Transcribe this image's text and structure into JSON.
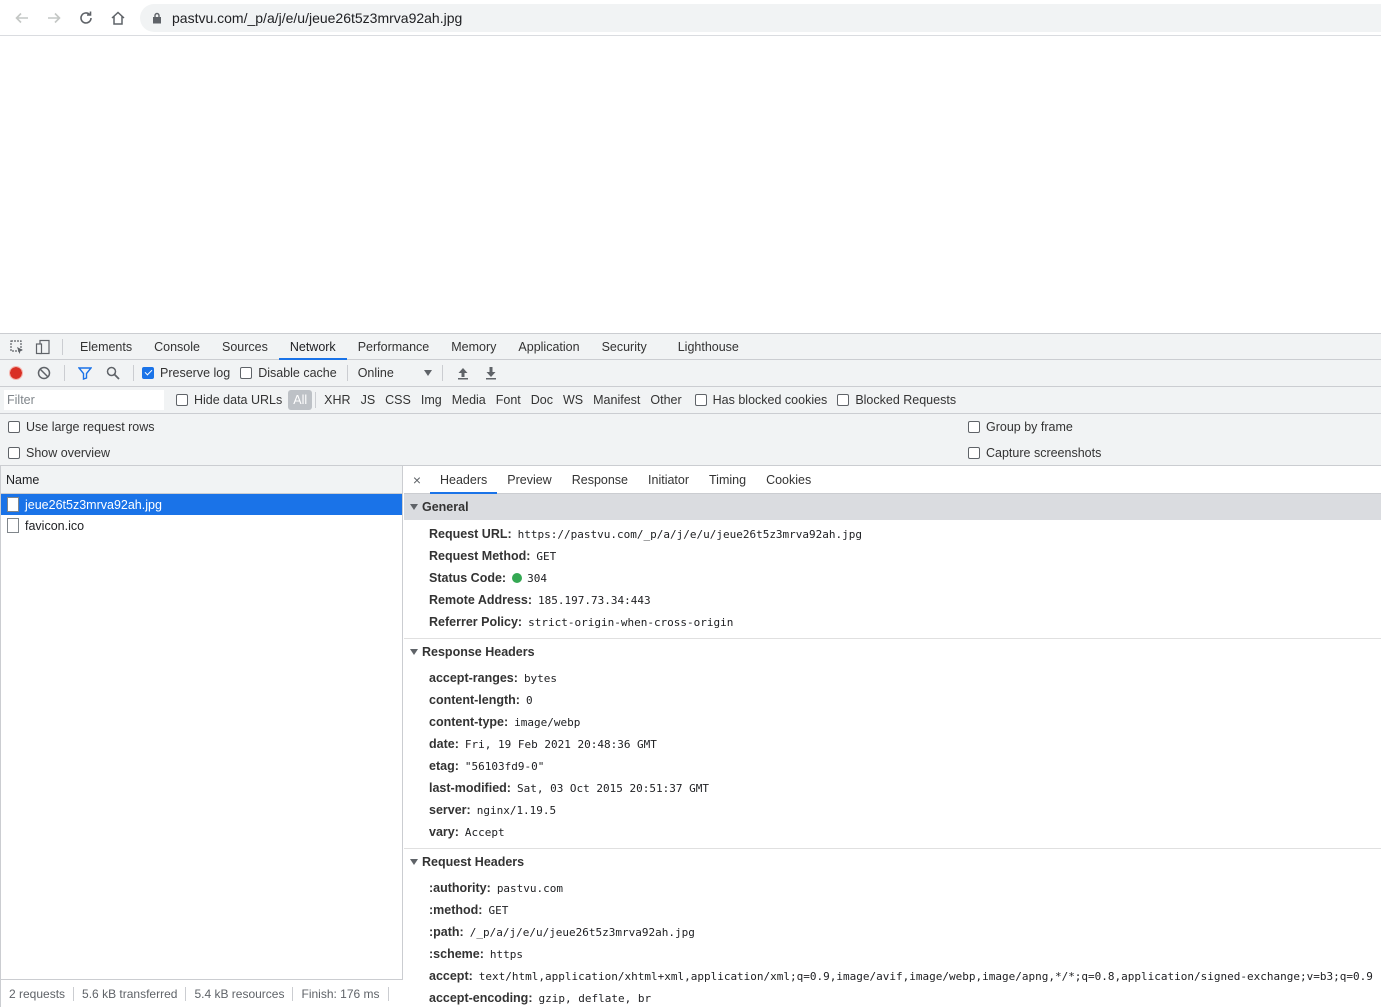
{
  "browser": {
    "url": "pastvu.com/_p/a/j/e/u/jeue26t5z3mrva92ah.jpg"
  },
  "devtools": {
    "tabs": [
      "Elements",
      "Console",
      "Sources",
      "Network",
      "Performance",
      "Memory",
      "Application",
      "Security",
      "Lighthouse"
    ],
    "active_tab": "Network",
    "toolbar": {
      "preserve_log": "Preserve log",
      "disable_cache": "Disable cache",
      "throttle": "Online"
    },
    "filter": {
      "placeholder": "Filter",
      "hide_data_urls": "Hide data URLs",
      "types": [
        "All",
        "XHR",
        "JS",
        "CSS",
        "Img",
        "Media",
        "Font",
        "Doc",
        "WS",
        "Manifest",
        "Other"
      ],
      "has_blocked_cookies": "Has blocked cookies",
      "blocked_requests": "Blocked Requests"
    },
    "options": {
      "large_rows": "Use large request rows",
      "show_overview": "Show overview",
      "group_by_frame": "Group by frame",
      "capture_screenshots": "Capture screenshots"
    },
    "requests": {
      "header": "Name",
      "items": [
        "jeue26t5z3mrva92ah.jpg",
        "favicon.ico"
      ]
    },
    "status": {
      "requests": "2 requests",
      "transferred": "5.6 kB transferred",
      "resources": "5.4 kB resources",
      "finish": "Finish: 176 ms"
    },
    "detail": {
      "close": "×",
      "tabs": [
        "Headers",
        "Preview",
        "Response",
        "Initiator",
        "Timing",
        "Cookies"
      ],
      "general": {
        "title": "General",
        "rows": [
          {
            "k": "Request URL:",
            "v": "https://pastvu.com/_p/a/j/e/u/jeue26t5z3mrva92ah.jpg"
          },
          {
            "k": "Request Method:",
            "v": "GET"
          },
          {
            "k": "Status Code:",
            "v": "304"
          },
          {
            "k": "Remote Address:",
            "v": "185.197.73.34:443"
          },
          {
            "k": "Referrer Policy:",
            "v": "strict-origin-when-cross-origin"
          }
        ]
      },
      "response_headers": {
        "title": "Response Headers",
        "rows": [
          {
            "k": "accept-ranges:",
            "v": "bytes"
          },
          {
            "k": "content-length:",
            "v": "0"
          },
          {
            "k": "content-type:",
            "v": "image/webp"
          },
          {
            "k": "date:",
            "v": "Fri, 19 Feb 2021 20:48:36 GMT"
          },
          {
            "k": "etag:",
            "v": "\"56103fd9-0\""
          },
          {
            "k": "last-modified:",
            "v": "Sat, 03 Oct 2015 20:51:37 GMT"
          },
          {
            "k": "server:",
            "v": "nginx/1.19.5"
          },
          {
            "k": "vary:",
            "v": "Accept"
          }
        ]
      },
      "request_headers": {
        "title": "Request Headers",
        "rows": [
          {
            "k": ":authority:",
            "v": "pastvu.com"
          },
          {
            "k": ":method:",
            "v": "GET"
          },
          {
            "k": ":path:",
            "v": "/_p/a/j/e/u/jeue26t5z3mrva92ah.jpg"
          },
          {
            "k": ":scheme:",
            "v": "https"
          },
          {
            "k": "accept:",
            "v": "text/html,application/xhtml+xml,application/xml;q=0.9,image/avif,image/webp,image/apng,*/*;q=0.8,application/signed-exchange;v=b3;q=0.9"
          },
          {
            "k": "accept-encoding:",
            "v": "gzip, deflate, br"
          }
        ]
      }
    }
  }
}
